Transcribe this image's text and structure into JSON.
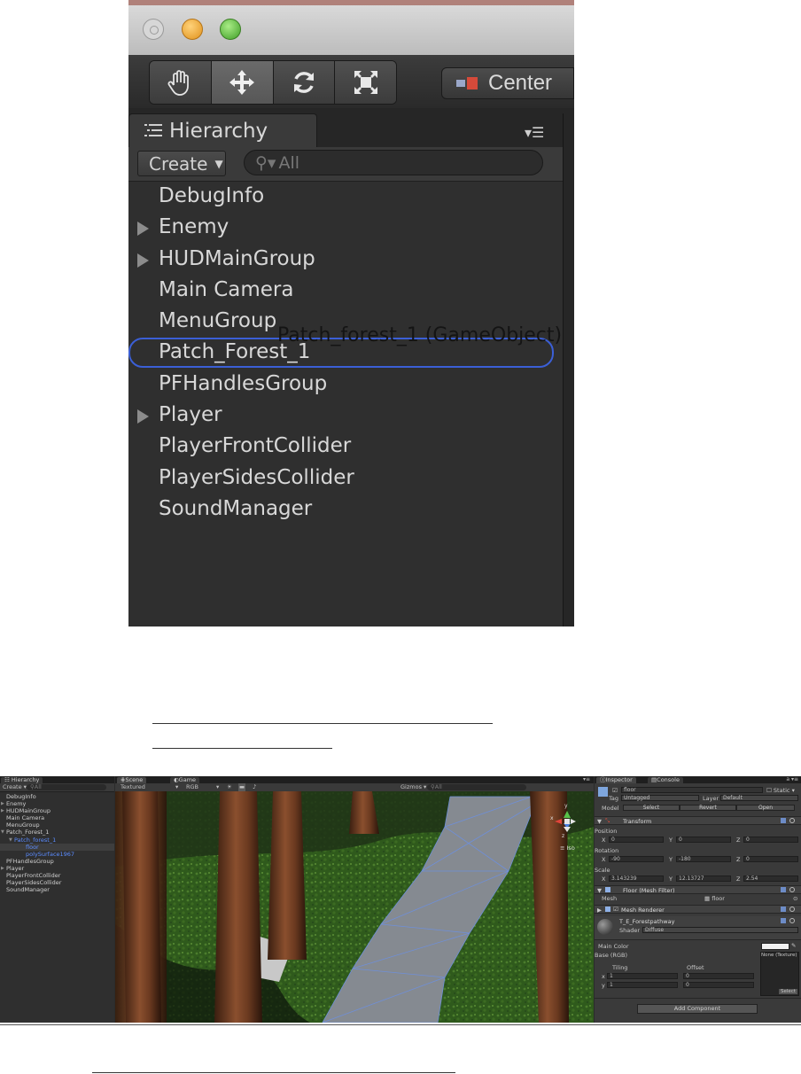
{
  "zoom": {
    "toolbar": {
      "center_label": "Center",
      "tools": [
        "hand-icon",
        "move-icon",
        "rotate-icon",
        "scale-icon"
      ]
    },
    "hierarchy_tab_label": "Hierarchy",
    "create_label": "Create",
    "search_placeholder": "All",
    "items": [
      {
        "label": "DebugInfo",
        "expandable": false
      },
      {
        "label": "Enemy",
        "expandable": true
      },
      {
        "label": "HUDMainGroup",
        "expandable": true
      },
      {
        "label": "Main Camera",
        "expandable": false
      },
      {
        "label": "MenuGroup",
        "expandable": false
      },
      {
        "label": "Patch_Forest_1",
        "expandable": false,
        "outlined": true
      },
      {
        "label": "PFHandlesGroup",
        "expandable": false
      },
      {
        "label": "Player",
        "expandable": true
      },
      {
        "label": "PlayerFrontCollider",
        "expandable": false
      },
      {
        "label": "PlayerSidesCollider",
        "expandable": false
      },
      {
        "label": "SoundManager",
        "expandable": false
      }
    ],
    "drag_tooltip": "Patch_forest_1 (GameObject)"
  },
  "editor": {
    "hierarchy": {
      "tab_label": "Hierarchy",
      "create_label": "Create",
      "search_placeholder": "All",
      "items": [
        "DebugInfo",
        "Enemy",
        "HUDMainGroup",
        "Main Camera",
        "MenuGroup",
        "Patch_Forest_1",
        "Patch_forest_1",
        "floor",
        "polySurface1967",
        "PFHandlesGroup",
        "Player",
        "PlayerFrontCollider",
        "PlayerSidesCollider",
        "SoundManager"
      ]
    },
    "scene": {
      "tab_scene": "Scene",
      "tab_game": "Game",
      "shading_mode": "Textured",
      "render_mode": "RGB",
      "gizmos_label": "Gizmos",
      "search_placeholder": "All",
      "persp_label": "Iso",
      "gizmo_axes": [
        "y",
        "x",
        "z"
      ]
    },
    "inspector": {
      "tab_inspector": "Inspector",
      "tab_console": "Console",
      "object_name": "floor",
      "static_label": "Static",
      "tag_label": "Tag",
      "tag_value": "Untagged",
      "layer_label": "Layer",
      "layer_value": "Default",
      "model_label": "Model",
      "select_label": "Select",
      "revert_label": "Revert",
      "open_label": "Open",
      "transform_label": "Transform",
      "position_label": "Position",
      "position": {
        "x": "0",
        "y": "0",
        "z": "0"
      },
      "rotation_label": "Rotation",
      "rotation": {
        "x": "-90",
        "y": "-180",
        "z": "0"
      },
      "scale_label": "Scale",
      "scale": {
        "x": "3.143239",
        "y": "12.13727",
        "z": "2.54"
      },
      "mesh_filter_label": "Floor (Mesh Filter)",
      "mesh_label": "Mesh",
      "mesh_value": "floor",
      "mesh_renderer_label": "Mesh Renderer",
      "material_name": "T_E_Forestpathway",
      "shader_label": "Shader",
      "shader_value": "Diffuse",
      "main_color_label": "Main Color",
      "base_rgb_label": "Base (RGB)",
      "texture_none": "None (Texture)",
      "tiling_label": "Tiling",
      "offset_label": "Offset",
      "tiling": {
        "x": "1",
        "y": "1"
      },
      "offset": {
        "x": "0",
        "y": "0"
      },
      "texture_select": "Select",
      "add_component_label": "Add Component"
    }
  }
}
